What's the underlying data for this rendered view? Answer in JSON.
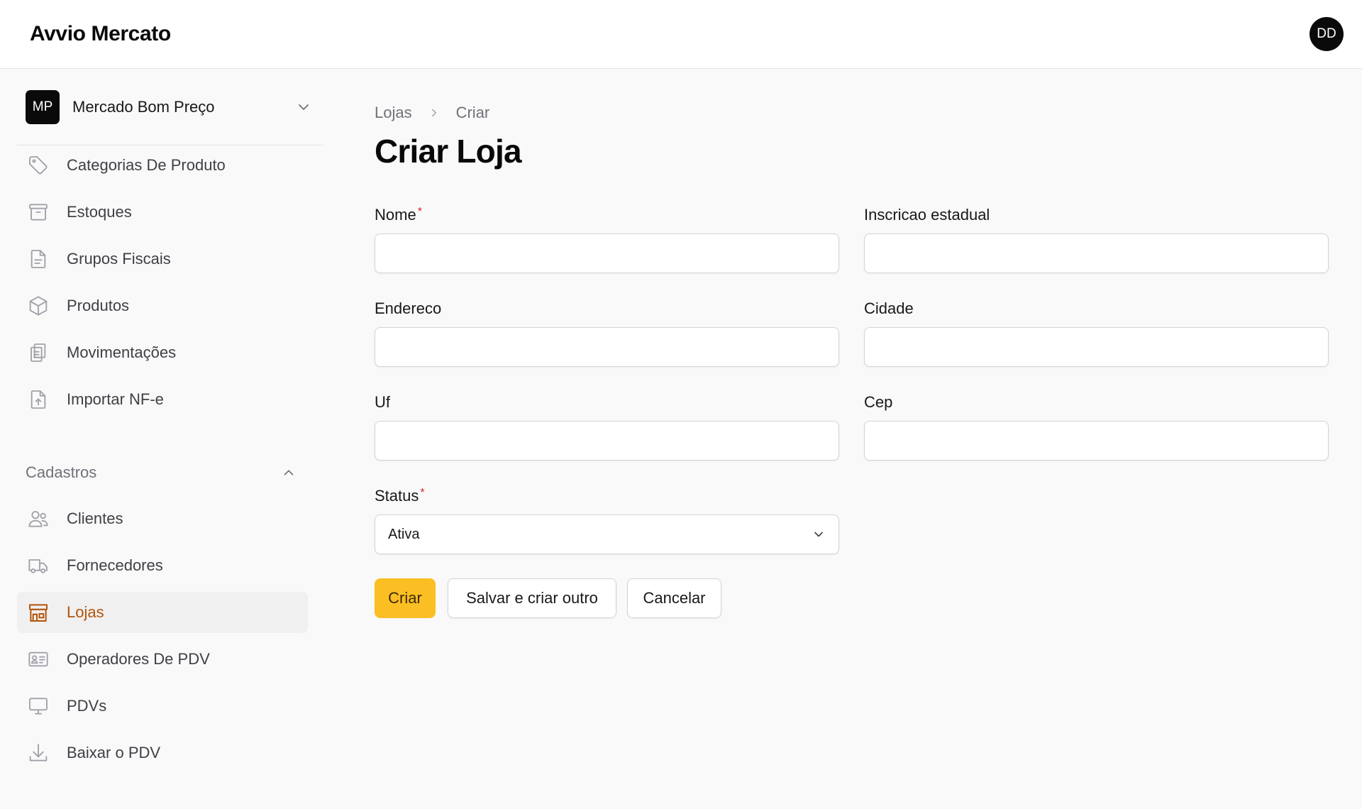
{
  "app": {
    "title": "Avvio Mercato"
  },
  "user": {
    "initials": "DD"
  },
  "tenant": {
    "initials": "MP",
    "name": "Mercado Bom Preço"
  },
  "sidebar": {
    "items": [
      {
        "label": "Categorias De Produto",
        "icon": "tag-icon"
      },
      {
        "label": "Estoques",
        "icon": "archive-box-icon"
      },
      {
        "label": "Grupos Fiscais",
        "icon": "document-text-icon"
      },
      {
        "label": "Produtos",
        "icon": "cube-icon"
      },
      {
        "label": "Movimentações",
        "icon": "clipboard-list-icon"
      },
      {
        "label": "Importar NF-e",
        "icon": "document-upload-icon"
      }
    ],
    "group": {
      "label": "Cadastros",
      "items": [
        {
          "label": "Clientes",
          "icon": "users-icon"
        },
        {
          "label": "Fornecedores",
          "icon": "truck-icon"
        },
        {
          "label": "Lojas",
          "icon": "storefront-icon",
          "active": true
        },
        {
          "label": "Operadores De PDV",
          "icon": "id-card-icon"
        },
        {
          "label": "PDVs",
          "icon": "monitor-icon"
        },
        {
          "label": "Baixar o PDV",
          "icon": "download-icon"
        }
      ]
    }
  },
  "breadcrumb": {
    "parent": "Lojas",
    "current": "Criar"
  },
  "page": {
    "title": "Criar Loja"
  },
  "form": {
    "nome": {
      "label": "Nome",
      "required": "*",
      "value": ""
    },
    "inscricao": {
      "label": "Inscricao estadual",
      "value": ""
    },
    "endereco": {
      "label": "Endereco",
      "value": ""
    },
    "cidade": {
      "label": "Cidade",
      "value": ""
    },
    "uf": {
      "label": "Uf",
      "value": ""
    },
    "cep": {
      "label": "Cep",
      "value": ""
    },
    "status": {
      "label": "Status",
      "required": "*",
      "value": "Ativa"
    }
  },
  "actions": {
    "create": "Criar",
    "save_and_create_another": "Salvar e criar outro",
    "cancel": "Cancelar"
  },
  "colors": {
    "accent": "#fbbf24",
    "active_text": "#b45309",
    "required": "#dc2626"
  }
}
